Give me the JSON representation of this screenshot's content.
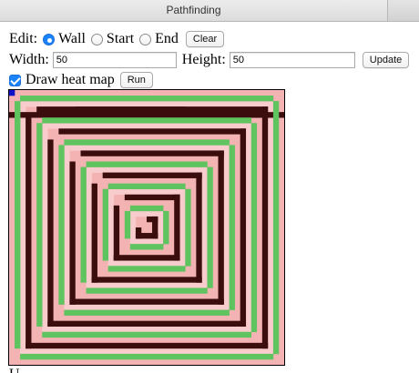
{
  "window": {
    "title": "Pathfinding"
  },
  "edit": {
    "label": "Edit:",
    "options": [
      {
        "label": "Wall",
        "checked": true
      },
      {
        "label": "Start",
        "checked": false
      },
      {
        "label": "End",
        "checked": false
      }
    ],
    "clear_label": "Clear"
  },
  "size": {
    "width_label": "Width:",
    "width_value": "50",
    "height_label": "Height:",
    "height_value": "50",
    "update_label": "Update"
  },
  "heatmap": {
    "label": "Draw heat map",
    "checked": true,
    "run_label": "Run"
  },
  "grid": {
    "cols": 50,
    "rows": 50,
    "colors": {
      "background": "#f4b3b3",
      "heat_light": "#f8cccc",
      "wall": "#3b0d0d",
      "path": "#5fc35f",
      "start": "#1010c8"
    }
  },
  "footer": {
    "label": "U"
  }
}
